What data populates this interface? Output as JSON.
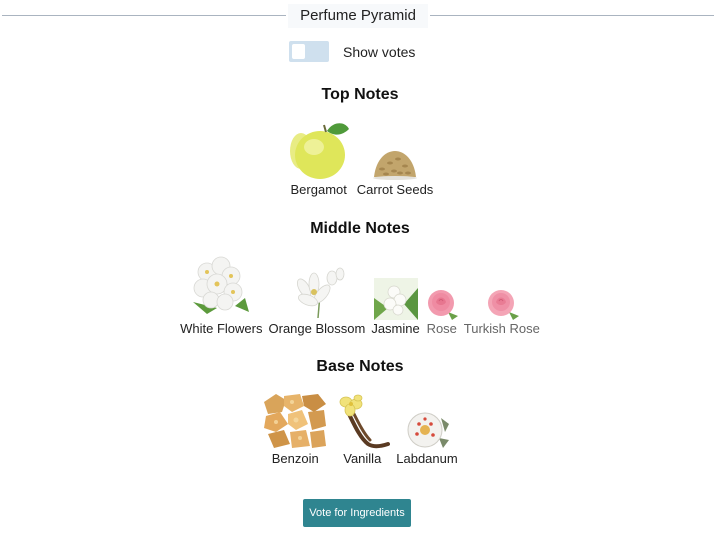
{
  "header": {
    "title": "Perfume Pyramid"
  },
  "toggle": {
    "label": "Show votes",
    "on": false
  },
  "sections": {
    "top": {
      "title": "Top Notes",
      "notes": [
        {
          "label": "Bergamot",
          "icon": "bergamot-icon"
        },
        {
          "label": "Carrot Seeds",
          "icon": "carrot-seeds-icon"
        }
      ]
    },
    "middle": {
      "title": "Middle Notes",
      "notes": [
        {
          "label": "White Flowers",
          "icon": "white-flowers-icon"
        },
        {
          "label": "Orange Blossom",
          "icon": "orange-blossom-icon"
        },
        {
          "label": "Jasmine",
          "icon": "jasmine-icon"
        },
        {
          "label": "Rose",
          "icon": "rose-icon"
        },
        {
          "label": "Turkish Rose",
          "icon": "turkish-rose-icon"
        }
      ]
    },
    "base": {
      "title": "Base Notes",
      "notes": [
        {
          "label": "Benzoin",
          "icon": "benzoin-icon"
        },
        {
          "label": "Vanilla",
          "icon": "vanilla-icon"
        },
        {
          "label": "Labdanum",
          "icon": "labdanum-icon"
        }
      ]
    }
  },
  "vote_button": {
    "label": "Vote for Ingredients"
  },
  "colors": {
    "accent": "#2f8590",
    "toggle_track": "#cfe0ee",
    "divider": "#aab4c0"
  }
}
